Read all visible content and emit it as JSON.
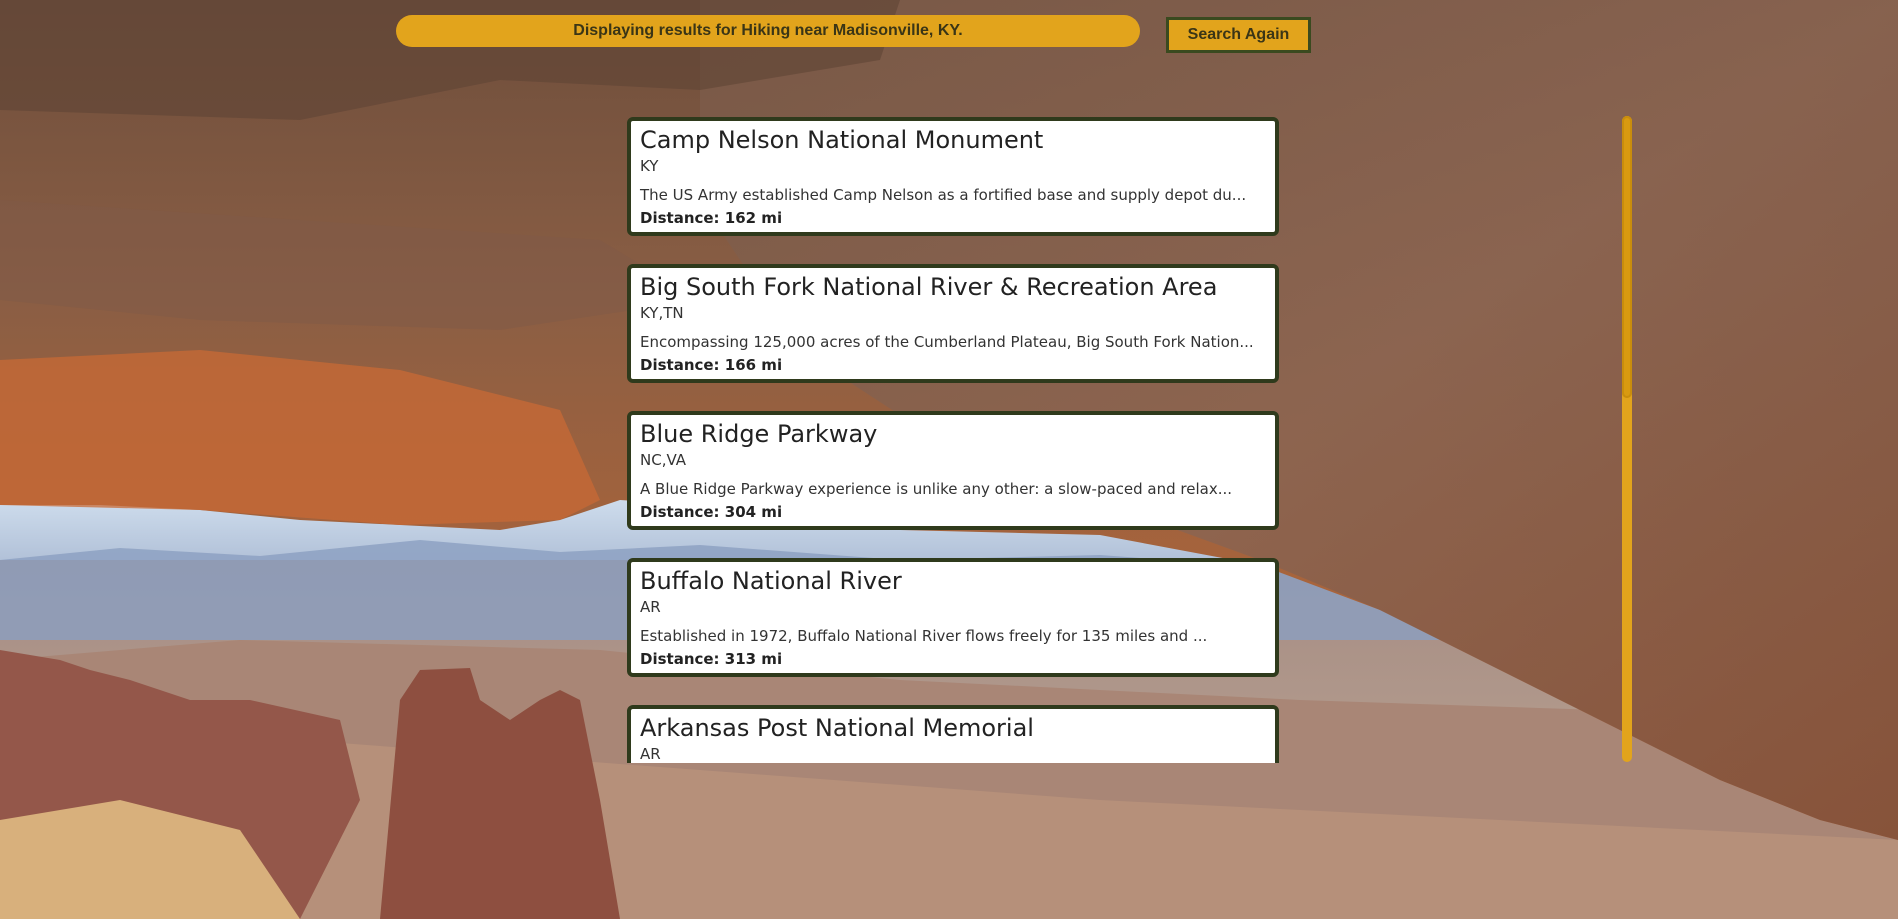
{
  "header": {
    "status_text": "Displaying results for Hiking near Madisonville, KY.",
    "search_again_label": "Search Again"
  },
  "results": [
    {
      "title": "Camp Nelson National Monument",
      "states": "KY",
      "description": "The US Army established Camp Nelson as a fortified base and supply depot du...",
      "distance": "Distance: 162 mi"
    },
    {
      "title": "Big South Fork National River & Recreation Area",
      "states": "KY,TN",
      "description": "Encompassing 125,000 acres of the Cumberland Plateau, Big South Fork Nation...",
      "distance": "Distance: 166 mi"
    },
    {
      "title": "Blue Ridge Parkway",
      "states": "NC,VA",
      "description": "A Blue Ridge Parkway experience is unlike any other: a slow-paced and relax...",
      "distance": "Distance: 304 mi"
    },
    {
      "title": "Buffalo National River",
      "states": "AR",
      "description": "Established in 1972, Buffalo National River flows freely for 135 miles and ...",
      "distance": "Distance: 313 mi"
    },
    {
      "title": "Arkansas Post National Memorial",
      "states": "AR",
      "description": "",
      "distance": ""
    }
  ],
  "colors": {
    "accent": "#e2a41c",
    "card_border": "#2f3a1c",
    "text": "#3a3516"
  },
  "scroll": {
    "position": 0.0
  }
}
